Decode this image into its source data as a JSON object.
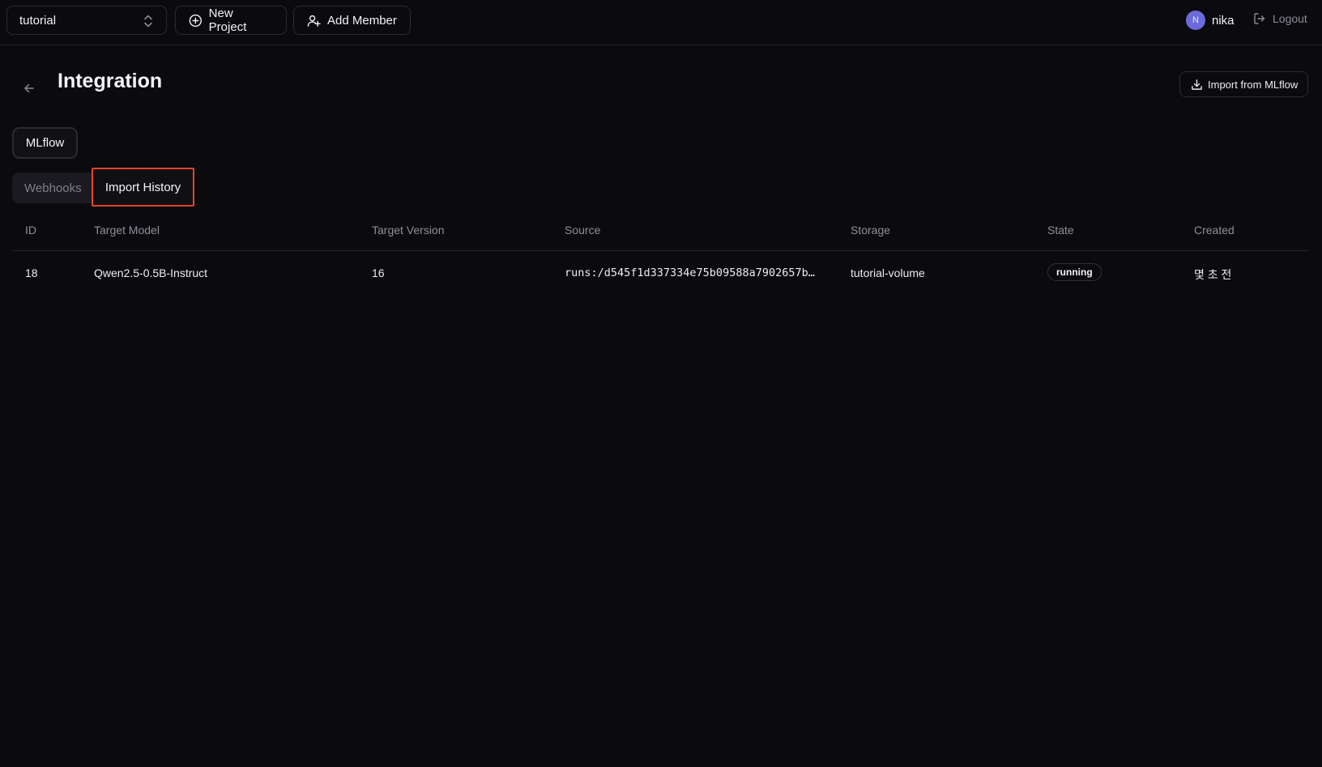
{
  "topbar": {
    "project": "tutorial",
    "new_project_label": "New Project",
    "add_member_label": "Add Member",
    "user_initial": "N",
    "user_name": "nika",
    "logout_label": "Logout"
  },
  "page": {
    "title": "Integration",
    "import_button_label": "Import from MLflow",
    "provider_tab": "MLflow",
    "subtabs": {
      "webhooks": "Webhooks",
      "import_history": "Import History"
    }
  },
  "table": {
    "headers": [
      "ID",
      "Target Model",
      "Target Version",
      "Source",
      "Storage",
      "State",
      "Created"
    ],
    "rows": [
      {
        "id": "18",
        "target_model": "Qwen2.5-0.5B-Instruct",
        "target_version": "16",
        "source": "runs:/d545f1d337334e75b09588a7902657b…",
        "storage": "tutorial-volume",
        "state": "running",
        "created": "몇 초 전"
      }
    ]
  },
  "colors": {
    "background": "#0b0b0f",
    "highlight_border": "#e8432c",
    "avatar": "#6b6bdc"
  }
}
